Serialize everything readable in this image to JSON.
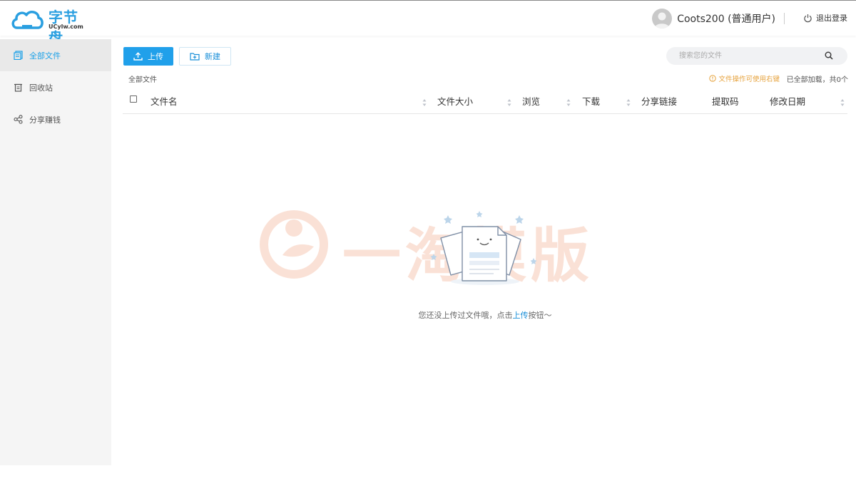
{
  "header": {
    "logo_title": "字节盘",
    "logo_sub": "UCylw.com",
    "user_name": "Coots200 (普通用户)",
    "logout_label": "退出登录"
  },
  "sidebar": {
    "items": [
      {
        "label": "全部文件",
        "icon": "files-icon",
        "active": true
      },
      {
        "label": "回收站",
        "icon": "trash-icon",
        "active": false
      },
      {
        "label": "分享赚钱",
        "icon": "share-icon",
        "active": false
      }
    ]
  },
  "toolbar": {
    "upload_label": "上传",
    "new_label": "新建",
    "search_placeholder": "搜索您的文件"
  },
  "breadcrumb": "全部文件",
  "tip": "文件操作可使用右键",
  "count_text": "已全部加载，共0个",
  "table": {
    "columns": [
      "文件名",
      "文件大小",
      "浏览",
      "下载",
      "分享链接",
      "提取码",
      "修改日期"
    ]
  },
  "empty": {
    "text_before": "您还没上传过文件哦，点击",
    "link": "上传",
    "text_after": "按钮～"
  },
  "watermark": "一淘模版",
  "colors": {
    "accent": "#20a0ea",
    "link": "#1a8fd8",
    "tip": "#e6a23c",
    "sidebar_bg": "#f5f5f5"
  }
}
